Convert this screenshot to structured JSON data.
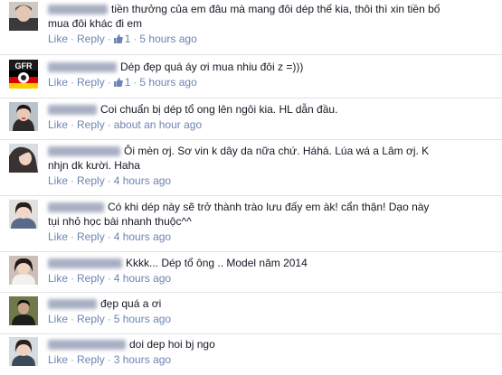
{
  "actions": {
    "like": "Like",
    "reply": "Reply",
    "dot": "·"
  },
  "comments": [
    {
      "text_line1": "tiền thưởng của em đâu mà mang đôi dép thế kia, thôi thì xin tiền bố",
      "text_line2": "mua đôi khác đi em",
      "likes": "1",
      "time": "5 hours ago",
      "avatar_icon": "profile-photo-icon"
    },
    {
      "text_line1": "Dép đẹp quá áy ơi mua nhiu đôi z =)))",
      "likes": "1",
      "time": "5 hours ago",
      "avatar_icon": "team-badge-icon",
      "avatar_text": "GFR"
    },
    {
      "text_line1": "Coi chuẩn bị dép tổ ong lên ngôi kia. HL dẫn đầu.",
      "time": "about an hour ago",
      "avatar_icon": "profile-photo-icon"
    },
    {
      "text_line1": "Ôi mèn ơj. Sơ vin k dây da nữa chứ. Háhá. Lúa wá a Lâm ơj. K",
      "text_line2": "nhjn dk kười. Haha",
      "time": "4 hours ago",
      "avatar_icon": "profile-photo-icon"
    },
    {
      "text_line1": "Có khi dép này sẽ trở thành trào lưu đấy em àk! cẩn thận! Dạo này",
      "text_line2": "tụi nhỏ học bài nhanh thuộc^^",
      "time": "4 hours ago",
      "avatar_icon": "profile-photo-icon"
    },
    {
      "text_line1": "Kkkk... Dép tổ ông .. Model năm 2014",
      "time": "4 hours ago",
      "avatar_icon": "profile-photo-icon"
    },
    {
      "text_line1": "đẹp quá a ơi",
      "time": "5 hours ago",
      "avatar_icon": "profile-photo-icon"
    },
    {
      "text_line1": "doi dep hoi bj ngo",
      "time": "3 hours ago",
      "avatar_icon": "profile-photo-icon"
    }
  ],
  "colors": {
    "link": "#6d84b4",
    "meta": "#9197a3",
    "text": "#141823",
    "separator": "#e1e2e5"
  }
}
